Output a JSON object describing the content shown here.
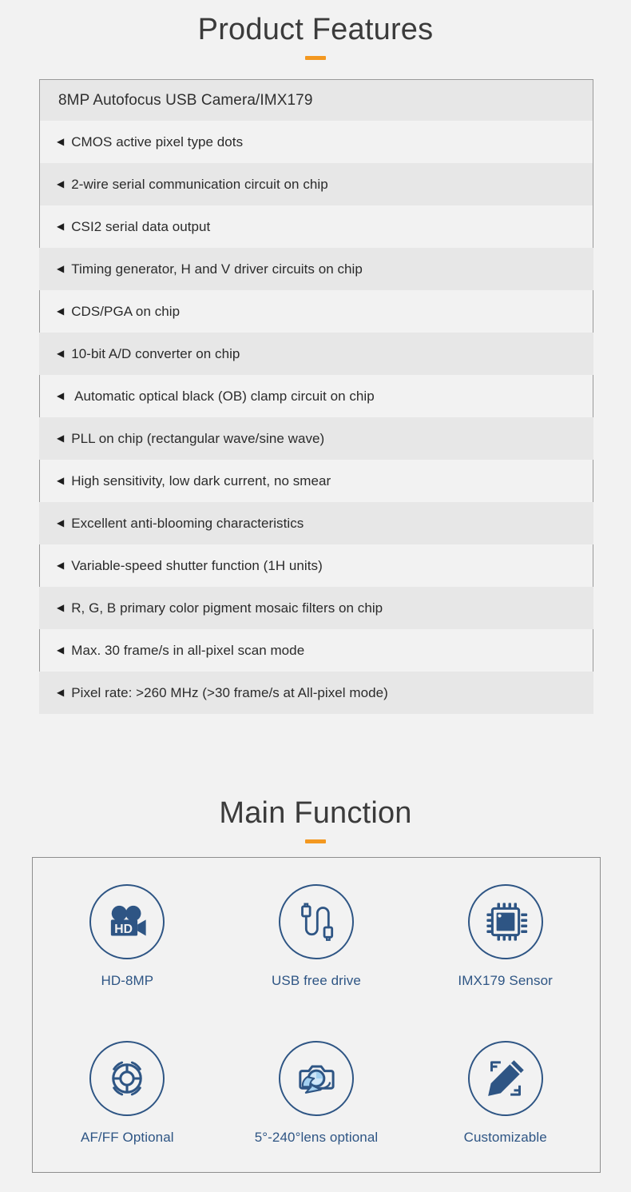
{
  "sections": {
    "features": {
      "heading": "Product Features",
      "accent_color": "#f39820",
      "table_header": "8MP Autofocus USB Camera/IMX179",
      "bullet_glyph": "◀",
      "rows": [
        "CMOS active pixel type dots",
        "2-wire serial communication circuit on chip",
        "CSI2 serial data output",
        "Timing generator, H and V driver circuits on chip",
        "CDS/PGA on chip",
        "10-bit A/D converter on chip",
        " Automatic optical black (OB) clamp circuit on chip",
        "PLL on chip (rectangular wave/sine wave)",
        "High sensitivity, low dark current, no smear",
        "Excellent anti-blooming characteristics",
        "Variable-speed shutter function (1H units)",
        "R, G, B primary color pigment mosaic filters on chip",
        "Max. 30 frame/s in all-pixel scan mode",
        "Pixel rate: >260 MHz (>30 frame/s at All-pixel mode)"
      ]
    },
    "main_function": {
      "heading": "Main Function",
      "accent_color": "#f39820",
      "icon_color": "#2e5584",
      "icon_accent_color": "#a3d0f0",
      "items": [
        {
          "icon": "hd-video-camera-icon",
          "label": "HD-8MP"
        },
        {
          "icon": "usb-cable-icon",
          "label": "USB free drive"
        },
        {
          "icon": "chip-sensor-icon",
          "label": "IMX179 Sensor"
        },
        {
          "icon": "lens-aperture-icon",
          "label": "AF/FF Optional"
        },
        {
          "icon": "camera-rotate-icon",
          "label": "5°-240°lens optional"
        },
        {
          "icon": "pencil-ruler-icon",
          "label": "Customizable"
        }
      ]
    }
  }
}
